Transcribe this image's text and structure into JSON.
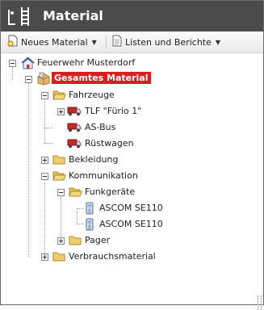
{
  "window": {
    "title": "Material"
  },
  "toolbar": {
    "new_label": "Neues Material",
    "reports_label": "Listen und Berichte"
  },
  "tree": {
    "root": "Feuerwehr Musterdorf",
    "selected": "Gesamtes Material",
    "fahrzeuge": "Fahrzeuge",
    "tlf": "TLF \"Fürio 1\"",
    "asbus": "AS-Bus",
    "ruestwagen": "Rüstwagen",
    "bekleidung": "Bekleidung",
    "kommunikation": "Kommunikation",
    "funkgeraete": "Funkgeräte",
    "ascom1": "ASCOM SE110",
    "ascom2": "ASCOM SE110",
    "pager": "Pager",
    "verbrauch": "Verbrauchsmaterial"
  },
  "colors": {
    "titlebar": "#4b4b4b",
    "selected": "#d71f1f"
  }
}
